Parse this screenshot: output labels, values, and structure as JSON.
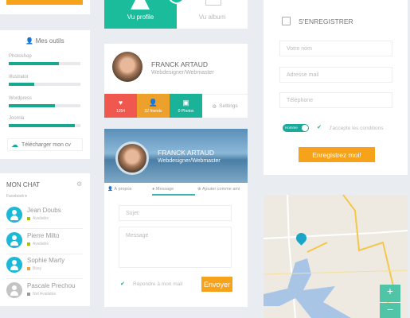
{
  "tools": {
    "title": "Mes outils",
    "skills": [
      {
        "name": "Photoshop",
        "level": 70
      },
      {
        "name": "Illustrator",
        "level": 35
      },
      {
        "name": "Wordpress",
        "level": 64
      },
      {
        "name": "Joomla",
        "level": 92
      }
    ],
    "download": "Télécharger mon cv"
  },
  "chat": {
    "title": "MON CHAT",
    "source": "Facebook",
    "contacts": [
      {
        "name": "Jean Doubs",
        "status": "Available",
        "color": "#a4c400"
      },
      {
        "name": "Pierre Milto",
        "status": "Available",
        "color": "#a4c400"
      },
      {
        "name": "Sophie Marty",
        "status": "Busy",
        "color": "#f0a040"
      },
      {
        "name": "Pascale Prechou",
        "status": "Not Available",
        "color": "#999999"
      }
    ]
  },
  "tabs": {
    "profile": "Vu profile",
    "album": "Vu album"
  },
  "profile": {
    "name": "FRANCK ARTAUD",
    "role": "Webdesigner/Webmaster",
    "likes": "1254",
    "friends": "32 friends",
    "photos": "0 Photos",
    "settings": "Settings"
  },
  "cover": {
    "name": "FRANCK ARTAUD",
    "role": "Webdesigner/Webmaster",
    "tabs": [
      "À propos",
      "Message",
      "Ajouter comme ami"
    ],
    "subject_placeholder": "Sujet",
    "message_placeholder": "Message",
    "reply_label": "Répondre à mon mail",
    "send": "Envoyer"
  },
  "register": {
    "title": "S'ENREGISTRER",
    "name_placeholder": "Votre nom",
    "email_placeholder": "Adresse mail",
    "phone_placeholder": "Téléphone",
    "gender": "Homme",
    "accept": "J'accepte les conditions",
    "submit": "Enregistrez moi!"
  },
  "map": {
    "zoom_in": "+",
    "zoom_out": "−"
  },
  "colors": {
    "teal": "#1abc9c",
    "orange": "#f7a21b",
    "red": "#f0584f"
  }
}
